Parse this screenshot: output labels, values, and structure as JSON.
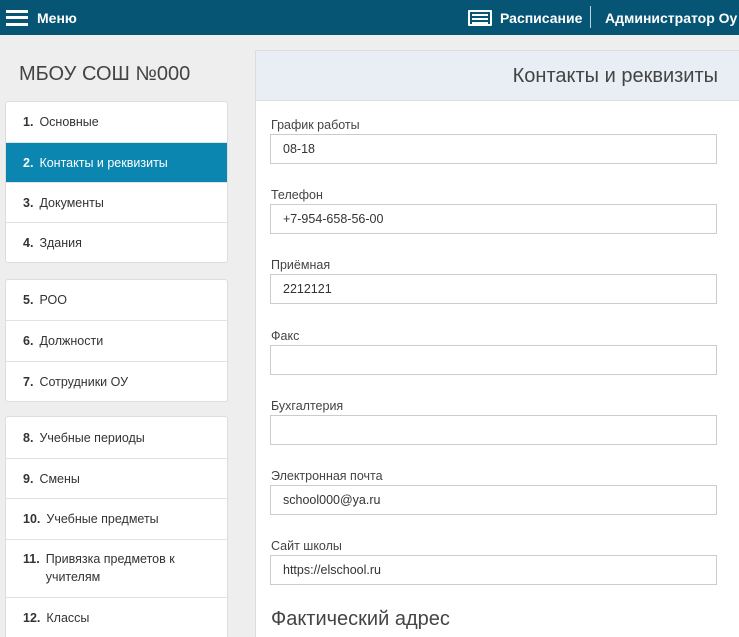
{
  "topbar": {
    "menu_label": "Меню",
    "schedule_label": "Расписание",
    "user_label": "Администратор Оу",
    "background": "#065574"
  },
  "org_title": "МБОУ СОШ №000",
  "nav_groups": [
    {
      "items": [
        {
          "num": "1.",
          "label": "Основные"
        },
        {
          "num": "2.",
          "label": "Контакты и реквизиты",
          "active": true
        },
        {
          "num": "3.",
          "label": "Документы"
        },
        {
          "num": "4.",
          "label": "Здания"
        }
      ]
    },
    {
      "items": [
        {
          "num": "5.",
          "label": "РОО"
        },
        {
          "num": "6.",
          "label": "Должности"
        },
        {
          "num": "7.",
          "label": "Сотрудники ОУ"
        }
      ]
    },
    {
      "items": [
        {
          "num": "8.",
          "label": "Учебные периоды"
        },
        {
          "num": "9.",
          "label": "Смены"
        },
        {
          "num": "10.",
          "label": "Учебные предметы"
        },
        {
          "num": "11.",
          "label": "Привязка предметов к учителям"
        },
        {
          "num": "12.",
          "label": "Классы"
        }
      ]
    }
  ],
  "panel": {
    "title": "Контакты и реквизиты",
    "fields": [
      {
        "label": "График работы",
        "value": "08-18"
      },
      {
        "label": "Телефон",
        "value": "+7-954-658-56-00"
      },
      {
        "label": "Приёмная",
        "value": "2212121"
      },
      {
        "label": "Факс",
        "value": ""
      },
      {
        "label": "Бухгалтерия",
        "value": ""
      },
      {
        "label": "Электронная почта",
        "value": "school000@ya.ru"
      },
      {
        "label": "Сайт школы",
        "value": "https://elschool.ru"
      }
    ],
    "section_title": "Фактический адрес"
  },
  "colors": {
    "accent": "#0b86b0",
    "panel_header": "#e8eef4"
  },
  "icons": {
    "menu": "hamburger-icon",
    "schedule": "schedule-icon"
  }
}
